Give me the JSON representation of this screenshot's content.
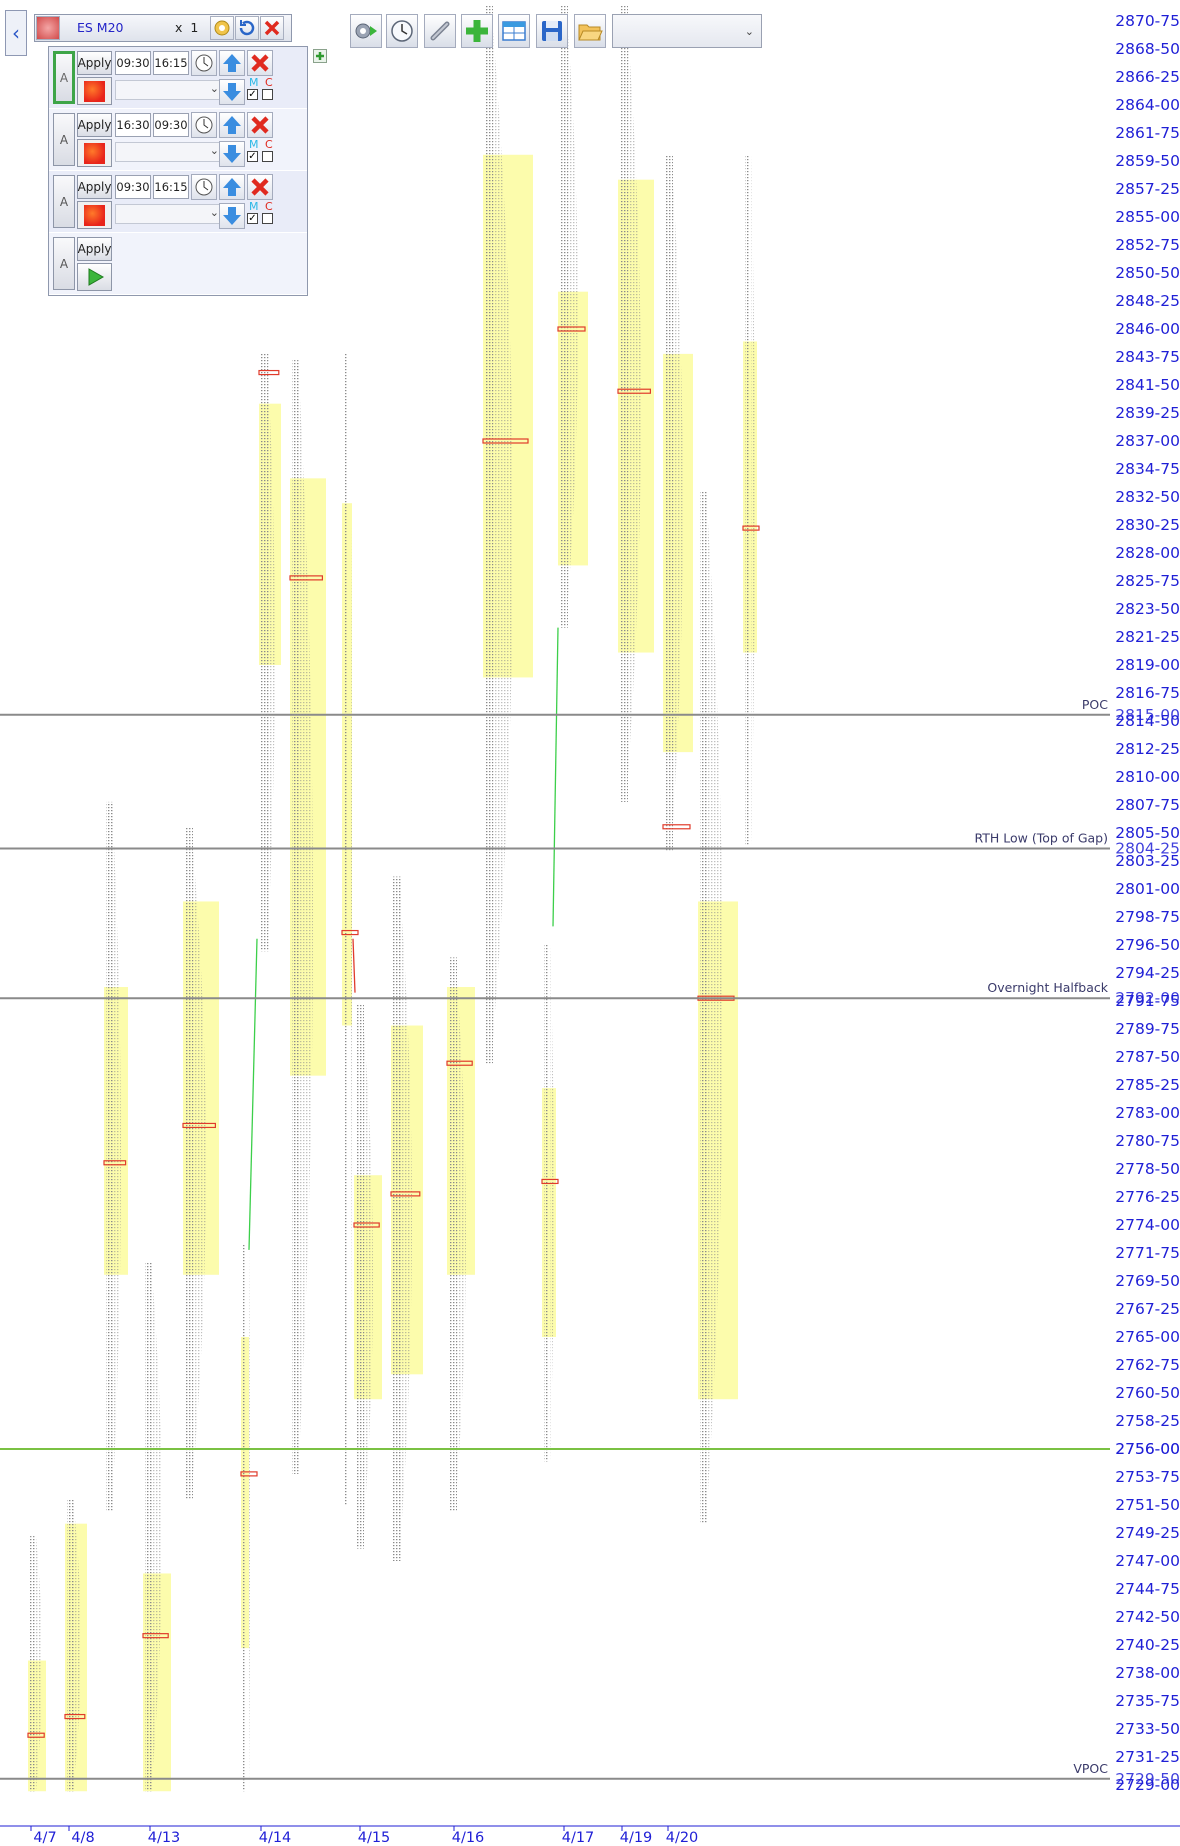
{
  "instrument": {
    "symbol": "ES M20",
    "multiplier_label": "x",
    "multiplier_value": "1"
  },
  "sessions": [
    {
      "letter": "A",
      "apply_label": "Apply",
      "start": "09:30",
      "end": "16:15",
      "m_label": "M",
      "c_label": "C",
      "m_checked": true,
      "c_checked": false,
      "active": true
    },
    {
      "letter": "A",
      "apply_label": "Apply",
      "start": "16:30",
      "end": "09:30",
      "m_label": "M",
      "c_label": "C",
      "m_checked": true,
      "c_checked": false,
      "active": false
    },
    {
      "letter": "A",
      "apply_label": "Apply",
      "start": "09:30",
      "end": "16:15",
      "m_label": "M",
      "c_label": "C",
      "m_checked": true,
      "c_checked": false,
      "active": false
    },
    {
      "letter": "A",
      "apply_label": "Apply"
    }
  ],
  "toolbar": {
    "icons": [
      "settings-run-icon",
      "clock-icon",
      "link-icon",
      "add-icon",
      "table-layout-icon",
      "save-icon",
      "open-folder-icon"
    ],
    "layout_select_value": ""
  },
  "chart_data": {
    "type": "market-profile",
    "y_tick_labels": [
      "2870-75",
      "2868-50",
      "2866-25",
      "2864-00",
      "2861-75",
      "2859-50",
      "2857-25",
      "2855-00",
      "2852-75",
      "2850-50",
      "2848-25",
      "2846-00",
      "2843-75",
      "2841-50",
      "2839-25",
      "2837-00",
      "2834-75",
      "2832-50",
      "2830-25",
      "2828-00",
      "2825-75",
      "2823-50",
      "2821-25",
      "2819-00",
      "2816-75",
      "2814-50",
      "2812-25",
      "2810-00",
      "2807-75",
      "2805-50",
      "2803-25",
      "2801-00",
      "2798-75",
      "2796-50",
      "2794-25",
      "2791-75",
      "2789-75",
      "2787-50",
      "2785-25",
      "2783-00",
      "2780-75",
      "2778-50",
      "2776-25",
      "2774-00",
      "2771-75",
      "2769-50",
      "2767-25",
      "2765-00",
      "2762-75",
      "2760-50",
      "2758-25",
      "2756-00",
      "2753-75",
      "2751-50",
      "2749-25",
      "2747-00",
      "2744-75",
      "2742-50",
      "2740-25",
      "2738-00",
      "2735-75",
      "2733-50",
      "2731-25",
      "2729-00"
    ],
    "x_tick_labels": [
      "4/7",
      "4/8",
      "4/13",
      "4/14",
      "4/15",
      "4/16",
      "4/17",
      "4/19",
      "4/20"
    ],
    "reference_lines": [
      {
        "label": "POC",
        "price": 2815.0,
        "price_label": "2815-00",
        "color": "#8a8a8a"
      },
      {
        "label": "RTH Low (Top of Gap)",
        "price": 2804.25,
        "price_label": "2804-25",
        "color": "#8a8a8a"
      },
      {
        "label": "Overnight Halfback",
        "price": 2792.0,
        "price_label": "2792-00",
        "color": "#8a8a8a"
      },
      {
        "label": "",
        "price": 2756.0,
        "price_label": "2756-00",
        "color": "#7ac143"
      },
      {
        "label": "VPOC",
        "price": 2729.5,
        "price_label": "2729-50",
        "color": "#8a8a8a"
      }
    ],
    "y_range": [
      2728.5,
      2872.0
    ],
    "profiles": [
      {
        "date": "4/7",
        "low": 2728.5,
        "high": 2749.0,
        "va_low": 2728.5,
        "va_high": 2739.0,
        "poc": 2733.0,
        "width": 18
      },
      {
        "date": "4/8",
        "low": 2728.5,
        "high": 2752.0,
        "va_low": 2728.5,
        "va_high": 2750.0,
        "poc": 2734.5,
        "width": 22
      },
      {
        "date": "4/8",
        "low": 2751.0,
        "high": 2808.0,
        "va_low": 2770.0,
        "va_high": 2793.0,
        "poc": 2779.0,
        "width": 24
      },
      {
        "date": "4/13",
        "low": 2728.5,
        "high": 2771.0,
        "va_low": 2728.5,
        "va_high": 2746.0,
        "poc": 2741.0,
        "width": 28
      },
      {
        "date": "4/13",
        "low": 2752.0,
        "high": 2806.0,
        "va_low": 2770.0,
        "va_high": 2800.0,
        "poc": 2782.0,
        "width": 36
      },
      {
        "date": "4/14",
        "low": 2728.5,
        "high": 2772.5,
        "va_low": 2740.0,
        "va_high": 2765.0,
        "poc": 2754.0,
        "width": 8
      },
      {
        "date": "4/14",
        "low": 2796.0,
        "high": 2844.0,
        "va_low": 2819.0,
        "va_high": 2840.0,
        "poc": 2842.5,
        "width": 22
      },
      {
        "date": "4/14",
        "low": 2754.0,
        "high": 2843.5,
        "va_low": 2786.0,
        "va_high": 2834.0,
        "poc": 2826.0,
        "width": 36
      },
      {
        "date": "4/15",
        "low": 2751.5,
        "high": 2844.0,
        "va_low": 2790.0,
        "va_high": 2832.0,
        "poc": 2797.5,
        "width": 10
      },
      {
        "date": "4/15",
        "low": 2748.0,
        "high": 2791.5,
        "va_low": 2760.0,
        "va_high": 2778.0,
        "poc": 2774.0,
        "width": 28
      },
      {
        "date": "4/15",
        "low": 2747.0,
        "high": 2802.0,
        "va_low": 2762.0,
        "va_high": 2790.0,
        "poc": 2776.5,
        "width": 32
      },
      {
        "date": "4/16",
        "low": 2751.0,
        "high": 2795.5,
        "va_low": 2770.0,
        "va_high": 2793.0,
        "poc": 2787.0,
        "width": 28
      },
      {
        "date": "4/16",
        "low": 2787.0,
        "high": 2872.0,
        "va_low": 2818.0,
        "va_high": 2860.0,
        "poc": 2837.0,
        "width": 50
      },
      {
        "date": "4/17",
        "low": 2755.0,
        "high": 2796.5,
        "va_low": 2765.0,
        "va_high": 2785.0,
        "poc": 2777.5,
        "width": 14
      },
      {
        "date": "4/17",
        "low": 2822.0,
        "high": 2872.0,
        "va_low": 2827.0,
        "va_high": 2849.0,
        "poc": 2846.0,
        "width": 30
      },
      {
        "date": "4/19",
        "low": 2808.0,
        "high": 2872.0,
        "va_low": 2820.0,
        "va_high": 2858.0,
        "poc": 2841.0,
        "width": 36
      },
      {
        "date": "4/20",
        "low": 2804.0,
        "high": 2860.0,
        "va_low": 2812.0,
        "va_high": 2844.0,
        "poc": 2806.0,
        "width": 30
      },
      {
        "date": "4/20",
        "low": 2750.0,
        "high": 2833.0,
        "va_low": 2760.0,
        "va_high": 2800.0,
        "poc": 2792.0,
        "width": 40
      },
      {
        "date": "4/20",
        "low": 2804.5,
        "high": 2860.0,
        "va_low": 2820.0,
        "va_high": 2845.0,
        "poc": 2830.0,
        "width": 14
      }
    ],
    "colors": {
      "axis_text": "#1f1fd6",
      "value_area": "#fbfb9e",
      "poc_marker": "#e03b2b",
      "letters": "#7a7a7a",
      "migration": "#3ccf4a"
    }
  }
}
